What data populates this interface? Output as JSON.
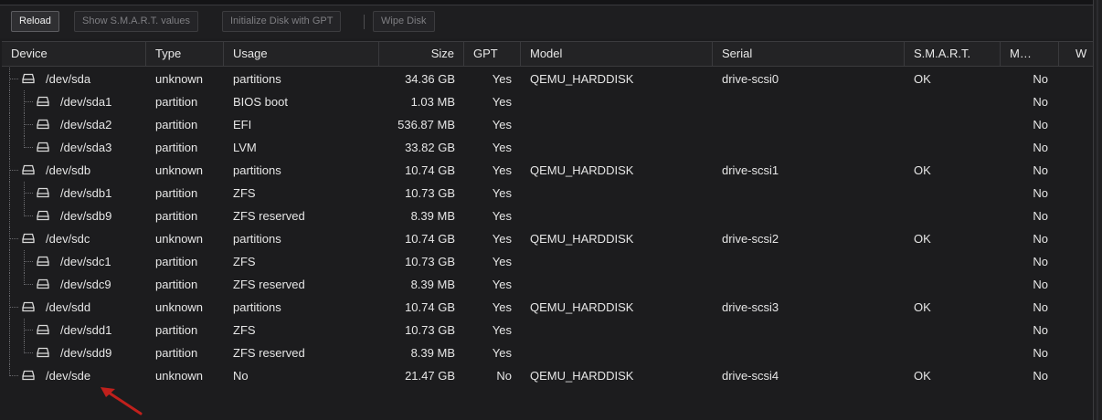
{
  "toolbar": {
    "reload": "Reload",
    "show_smart": "Show S.M.A.R.T. values",
    "init_gpt": "Initialize Disk with GPT",
    "wipe": "Wipe Disk"
  },
  "columns": {
    "device": "Device",
    "type": "Type",
    "usage": "Usage",
    "size": "Size",
    "gpt": "GPT",
    "model": "Model",
    "serial": "Serial",
    "smart": "S.M.A.R.T.",
    "mounted": "M…",
    "wearout": "W"
  },
  "rows": [
    {
      "device": "/dev/sda",
      "type": "unknown",
      "usage": "partitions",
      "size": "34.36 GB",
      "gpt": "Yes",
      "model": "QEMU_HARDDISK",
      "serial": "drive-scsi0",
      "smart": "OK",
      "mounted": "No"
    },
    {
      "device": "/dev/sda1",
      "type": "partition",
      "usage": "BIOS boot",
      "size": "1.03 MB",
      "gpt": "Yes",
      "model": "",
      "serial": "",
      "smart": "",
      "mounted": "No"
    },
    {
      "device": "/dev/sda2",
      "type": "partition",
      "usage": "EFI",
      "size": "536.87 MB",
      "gpt": "Yes",
      "model": "",
      "serial": "",
      "smart": "",
      "mounted": "No"
    },
    {
      "device": "/dev/sda3",
      "type": "partition",
      "usage": "LVM",
      "size": "33.82 GB",
      "gpt": "Yes",
      "model": "",
      "serial": "",
      "smart": "",
      "mounted": "No"
    },
    {
      "device": "/dev/sdb",
      "type": "unknown",
      "usage": "partitions",
      "size": "10.74 GB",
      "gpt": "Yes",
      "model": "QEMU_HARDDISK",
      "serial": "drive-scsi1",
      "smart": "OK",
      "mounted": "No"
    },
    {
      "device": "/dev/sdb1",
      "type": "partition",
      "usage": "ZFS",
      "size": "10.73 GB",
      "gpt": "Yes",
      "model": "",
      "serial": "",
      "smart": "",
      "mounted": "No"
    },
    {
      "device": "/dev/sdb9",
      "type": "partition",
      "usage": "ZFS reserved",
      "size": "8.39 MB",
      "gpt": "Yes",
      "model": "",
      "serial": "",
      "smart": "",
      "mounted": "No"
    },
    {
      "device": "/dev/sdc",
      "type": "unknown",
      "usage": "partitions",
      "size": "10.74 GB",
      "gpt": "Yes",
      "model": "QEMU_HARDDISK",
      "serial": "drive-scsi2",
      "smart": "OK",
      "mounted": "No"
    },
    {
      "device": "/dev/sdc1",
      "type": "partition",
      "usage": "ZFS",
      "size": "10.73 GB",
      "gpt": "Yes",
      "model": "",
      "serial": "",
      "smart": "",
      "mounted": "No"
    },
    {
      "device": "/dev/sdc9",
      "type": "partition",
      "usage": "ZFS reserved",
      "size": "8.39 MB",
      "gpt": "Yes",
      "model": "",
      "serial": "",
      "smart": "",
      "mounted": "No"
    },
    {
      "device": "/dev/sdd",
      "type": "unknown",
      "usage": "partitions",
      "size": "10.74 GB",
      "gpt": "Yes",
      "model": "QEMU_HARDDISK",
      "serial": "drive-scsi3",
      "smart": "OK",
      "mounted": "No"
    },
    {
      "device": "/dev/sdd1",
      "type": "partition",
      "usage": "ZFS",
      "size": "10.73 GB",
      "gpt": "Yes",
      "model": "",
      "serial": "",
      "smart": "",
      "mounted": "No"
    },
    {
      "device": "/dev/sdd9",
      "type": "partition",
      "usage": "ZFS reserved",
      "size": "8.39 MB",
      "gpt": "Yes",
      "model": "",
      "serial": "",
      "smart": "",
      "mounted": "No"
    },
    {
      "device": "/dev/sde",
      "type": "unknown",
      "usage": "No",
      "size": "21.47 GB",
      "gpt": "No",
      "model": "QEMU_HARDDISK",
      "serial": "drive-scsi4",
      "smart": "OK",
      "mounted": "No"
    }
  ],
  "colors": {
    "background": "#1c1c1e",
    "text": "#e6e6e6",
    "annotation_arrow": "#c0201c"
  },
  "icons": {
    "disk": "hard-disk-icon",
    "annotation": "red-arrow-annotation"
  }
}
